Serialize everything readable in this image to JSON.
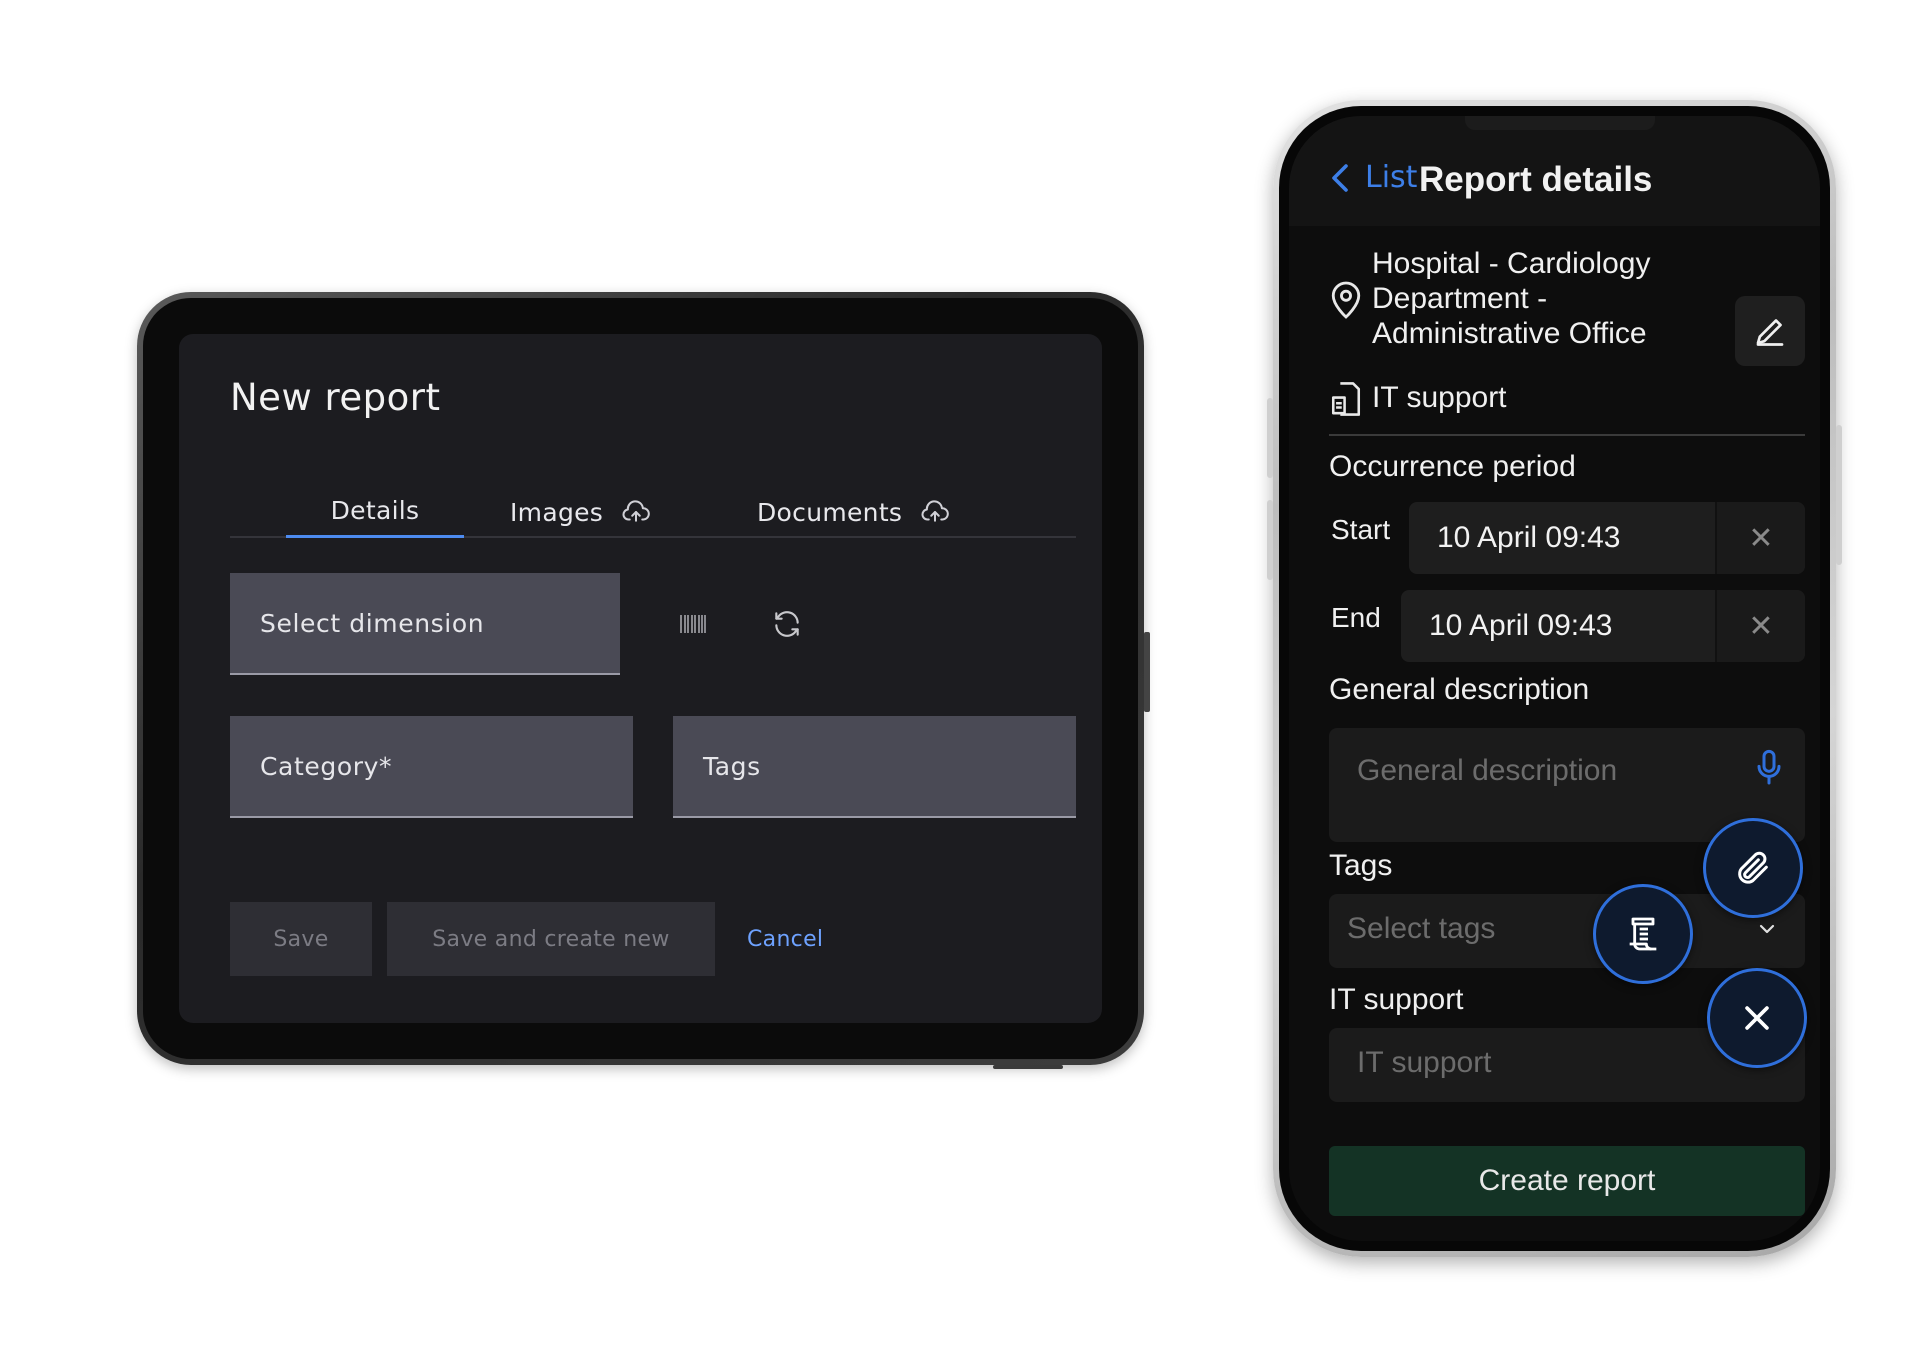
{
  "tablet": {
    "title": "New report",
    "tabs": [
      {
        "label": "Details",
        "active": true
      },
      {
        "label": "Images",
        "icon": "cloud-upload-icon"
      },
      {
        "label": "Documents",
        "icon": "cloud-upload-icon"
      }
    ],
    "select_dimension": "Select dimension",
    "category": "Category*",
    "tags": "Tags",
    "icons": [
      "barcode-icon",
      "refresh-icon"
    ],
    "buttons": {
      "save": "Save",
      "save_and_new": "Save and create new",
      "cancel": "Cancel"
    }
  },
  "phone": {
    "back_label": "List",
    "title": "Report details",
    "location_lines": [
      "Hospital - Cardiology",
      "Department  -",
      "Administrative Office"
    ],
    "category": "IT support",
    "occurrence_heading": "Occurrence period",
    "start_label": "Start",
    "start_value": "10 April 09:43",
    "end_label": "End",
    "end_value": "10 April 09:43",
    "general_description_heading": "General description",
    "general_description_placeholder": "General description",
    "tags_heading": "Tags",
    "tags_placeholder": "Select tags",
    "it_support_heading": "IT support",
    "it_support_placeholder": "IT support",
    "create_button": "Create report",
    "fab_icons": [
      "paperclip-icon",
      "document-list-icon",
      "close-icon"
    ]
  },
  "colors": {
    "accent_blue": "#3d7fe8",
    "tab_underline": "#4d8bf0",
    "create_button_bg": "#143325",
    "fab_border": "#2f6fdb"
  }
}
